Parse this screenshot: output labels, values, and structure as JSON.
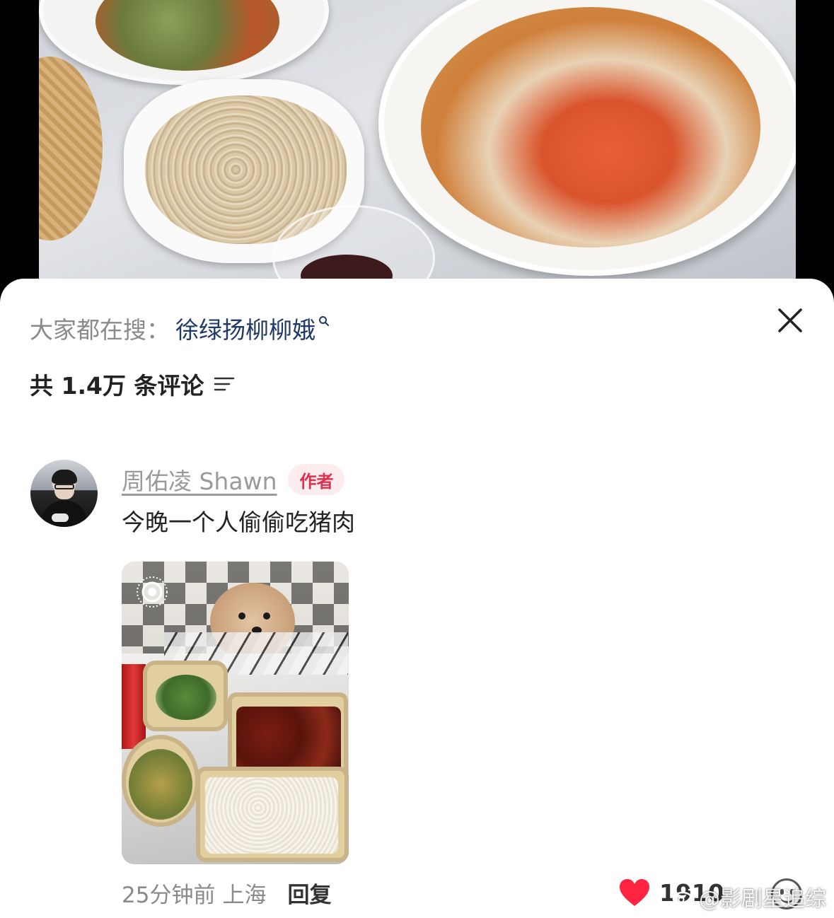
{
  "video": {
    "description_icon": "video-background"
  },
  "panel": {
    "hot_search": {
      "prefix": "大家都在搜：",
      "term": "徐绿扬柳柳娥",
      "icon": "search-icon"
    },
    "close_icon": "close-icon",
    "comment_count": {
      "label": "共 1.4万 条评论",
      "sort_icon": "sort-icon"
    }
  },
  "comment": {
    "author": "周佑凌 Shawn",
    "badge": "作者",
    "text": "今晚一个人偷偷吃猪肉",
    "image_icon": "live-photo-icon",
    "time": "25分钟前",
    "location": "上海",
    "reply_label": "回复",
    "like_count": "1910",
    "like_color": "#ff2442"
  },
  "watermark": {
    "text": "@影剧星追综"
  }
}
